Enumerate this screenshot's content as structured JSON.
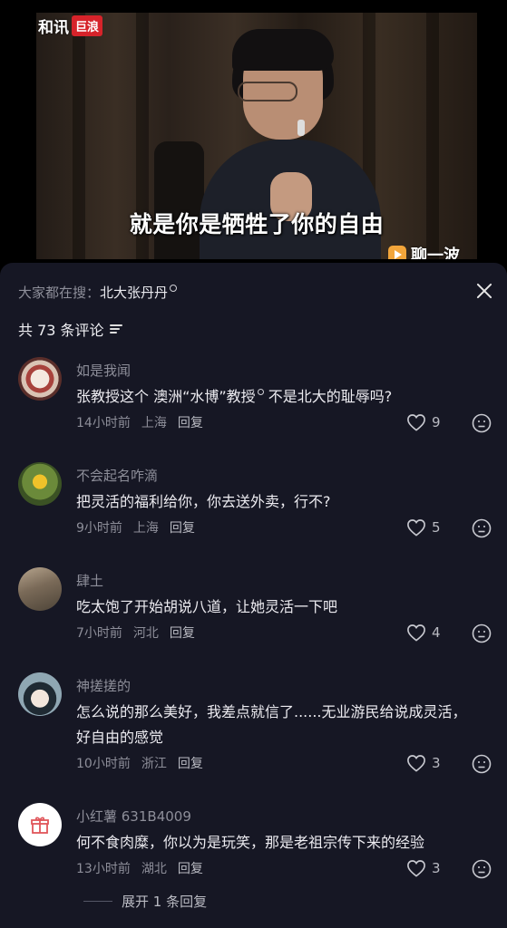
{
  "video": {
    "logo_text": "和讯",
    "logo_badge": "巨浪",
    "subtitle": "就是你是牺牲了你的自由",
    "watermark": "聊一波"
  },
  "sheet": {
    "search_prefix": "大家都在搜：",
    "search_term": "北大张丹丹",
    "comment_count_label": "共 73 条评论"
  },
  "comments": [
    {
      "name": "如是我闻",
      "text": "张教授这个 澳洲“水博”教授",
      "text_suffix": " 不是北大的耻辱吗?",
      "time": "14小时前",
      "location": "上海",
      "reply": "回复",
      "likes": "9",
      "avatar_color": "#8a3b3b"
    },
    {
      "name": "不会起名咋滴",
      "text": "把灵活的福利给你，你去送外卖，行不?",
      "time": "9小时前",
      "location": "上海",
      "reply": "回复",
      "likes": "5",
      "avatar_color": "#4a6a2a"
    },
    {
      "name": "肆土",
      "text": "吃太饱了开始胡说八道，让她灵活一下吧",
      "time": "7小时前",
      "location": "河北",
      "reply": "回复",
      "likes": "4",
      "avatar_color": "#6b5a48"
    },
    {
      "name": "神搓搓的",
      "text": "怎么说的那么美好，我差点就信了......无业游民给说成灵活，好自由的感觉",
      "time": "10小时前",
      "location": "浙江",
      "reply": "回复",
      "likes": "3",
      "avatar_color": "#3a4f5e"
    },
    {
      "name": "小红薯 631B4009",
      "text": "何不食肉糜，你以为是玩笑，那是老祖宗传下来的经验",
      "time": "13小时前",
      "location": "湖北",
      "reply": "回复",
      "likes": "3",
      "avatar_color": "#ffffff"
    }
  ],
  "expand_label": "展开 1 条回复"
}
